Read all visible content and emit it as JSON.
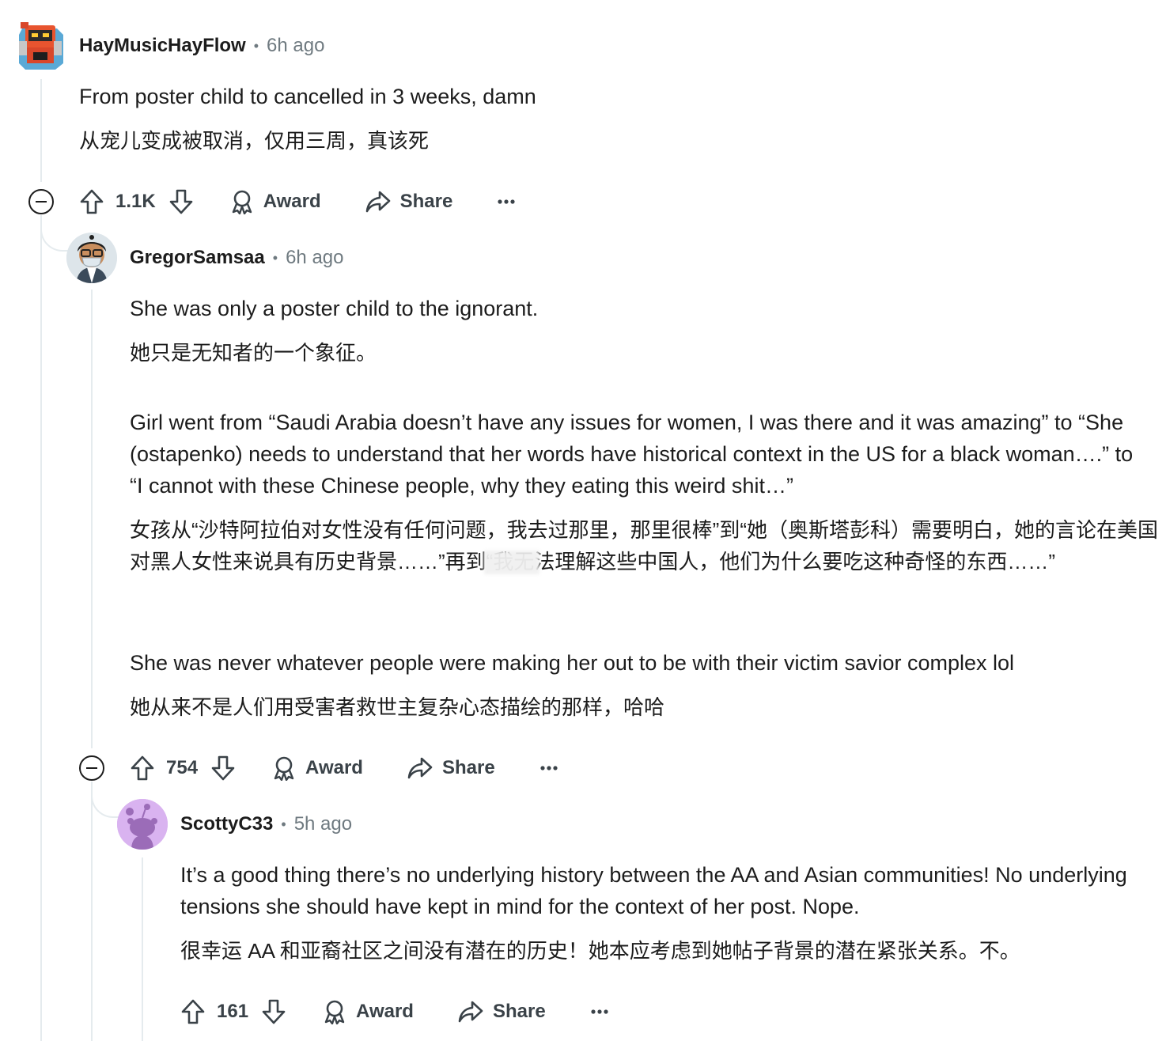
{
  "comments": [
    {
      "username": "HayMusicHayFlow",
      "time": "6h ago",
      "avatar_icon": "robot-avatar-icon",
      "body": [
        "From poster child to cancelled in 3 weeks, damn",
        "从宠儿变成被取消，仅用三周，真该死"
      ],
      "votes": "1.1K"
    },
    {
      "username": "GregorSamsaa",
      "time": "6h ago",
      "avatar_icon": "masked-person-avatar-icon",
      "body": [
        "She was only a poster child to the ignorant.",
        "她只是无知者的一个象征。",
        "Girl went from “Saudi Arabia doesn’t have any issues for women, I was there and it was amazing” to “She (ostapenko) needs to understand that her words have historical context in the US for a black woman….” to “I cannot with these Chinese people, why they eating this weird shit…”",
        "女孩从“沙特阿拉伯对女性没有任何问题，我去过那里，那里很棒”到“她（奥斯塔彭科）需要明白，她的言论在美国对黑人女性来说具有历史背景……”再到“我无法理解这些中国人，他们为什么要吃这种奇怪的东西……”",
        "She was never whatever people were making her out to be with their victim savior complex lol",
        "她从来不是人们用受害者救世主复杂心态描绘的那样，哈哈"
      ],
      "votes": "754"
    },
    {
      "username": "ScottyC33",
      "time": "5h ago",
      "avatar_icon": "snoo-avatar-icon",
      "body": [
        "It’s a good thing there’s no underlying history between the AA and Asian communities! No underlying tensions she should have kept in mind for the context of her post. Nope.",
        "很幸运 AA 和亚裔社区之间没有潜在的历史！她本应考虑到她帖子背景的潜在紧张关系。不。"
      ],
      "votes": "161"
    }
  ],
  "actions": {
    "award_label": "Award",
    "share_label": "Share",
    "separator": "•"
  },
  "colors": {
    "thread_line": "#e5ebee",
    "meta_text": "#6f7a80",
    "action_text": "#3a4248",
    "snoo_bg": "#d9b3f0"
  }
}
